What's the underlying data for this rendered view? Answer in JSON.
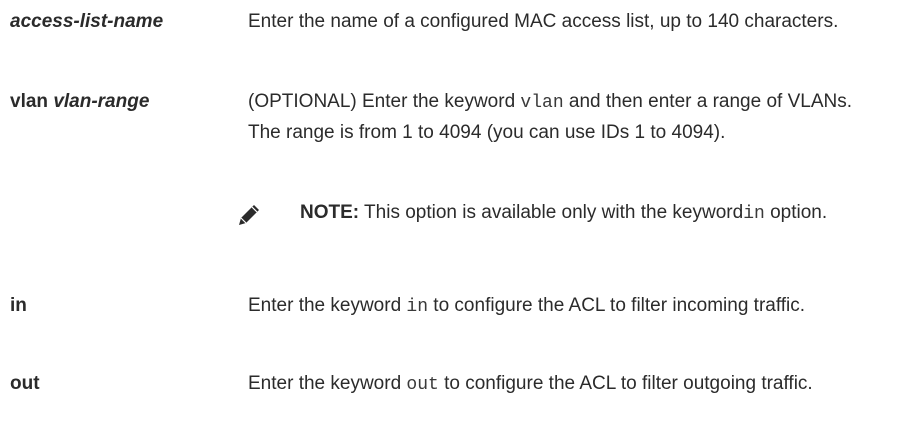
{
  "rows": [
    {
      "term": "access-list-name",
      "desc": "Enter the name of a configured MAC access list, up to 140 characters."
    },
    {
      "term_keyword": "vlan",
      "term_arg": "vlan-range",
      "desc_pre": "(OPTIONAL) Enter the keyword ",
      "desc_code": "vlan",
      "desc_post": " and then enter a range of VLANs. The range is from 1 to 4094 (you can use IDs 1 to 4094)."
    },
    {
      "term": "in",
      "desc_pre": "Enter the keyword ",
      "desc_code": "in",
      "desc_post": " to configure the ACL to filter incoming traffic."
    },
    {
      "term": "out",
      "desc_pre": "Enter the keyword ",
      "desc_code": "out",
      "desc_post": " to configure the ACL to filter outgoing traffic."
    }
  ],
  "note": {
    "label": "NOTE:",
    "text_pre": " This option is available only with the keyword",
    "code": "in",
    "text_post": " option.",
    "icon": "pencil-icon"
  }
}
